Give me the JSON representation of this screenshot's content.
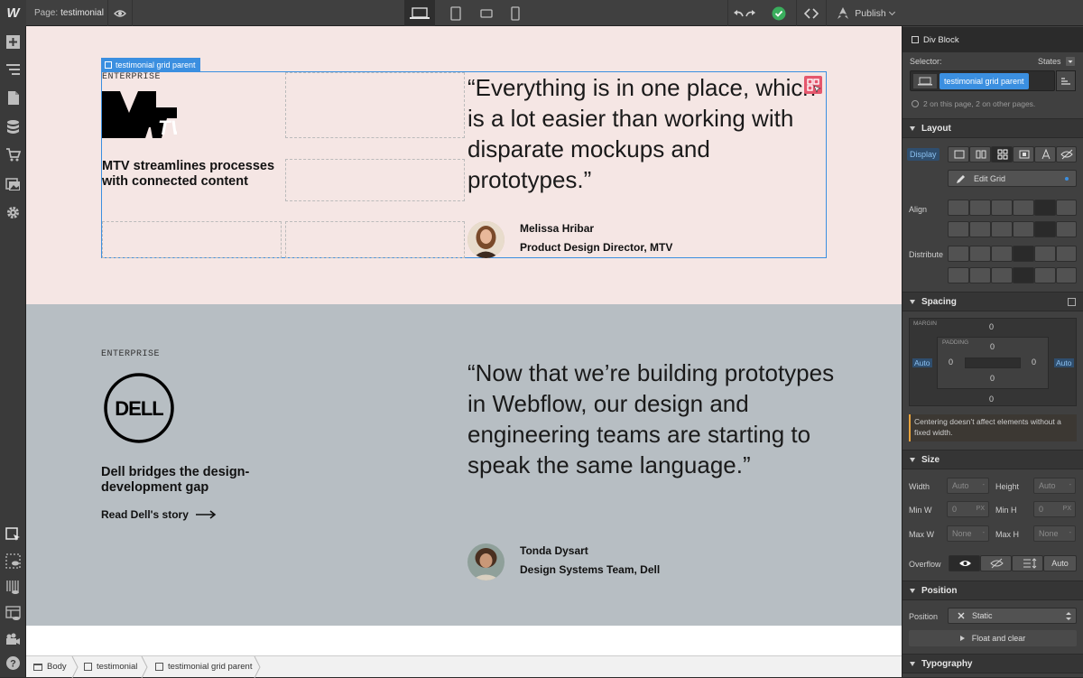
{
  "topbar": {
    "page_label": "Page:",
    "page_name": "testimonial",
    "publish_label": "Publish"
  },
  "panel": {
    "tabs": [
      "style-brush-icon",
      "gear-icon",
      "drops-icon",
      "lightning-icon"
    ],
    "element_type": "Div Block",
    "selector_label": "Selector:",
    "states_label": "States",
    "selector_chip": "testimonial grid parent",
    "usage_note": "2 on this page, 2 on other pages.",
    "layout": {
      "title": "Layout",
      "display_label": "Display",
      "edit_grid_label": "Edit Grid",
      "align_label": "Align",
      "distribute_label": "Distribute"
    },
    "spacing": {
      "title": "Spacing",
      "margin_label": "MARGIN",
      "padding_label": "PADDING",
      "margin_top": "0",
      "margin_bottom": "0",
      "margin_left": "Auto",
      "margin_right": "Auto",
      "padding_top": "0",
      "padding_bottom": "0",
      "padding_left": "0",
      "padding_right": "0",
      "warning": "Centering doesn’t affect elements without a fixed width."
    },
    "size": {
      "title": "Size",
      "width_label": "Width",
      "width_value": "Auto",
      "height_label": "Height",
      "height_value": "Auto",
      "minw_label": "Min W",
      "minw_value": "0",
      "minh_label": "Min H",
      "minh_value": "0",
      "maxw_label": "Max W",
      "maxw_value": "None",
      "maxh_label": "Max H",
      "maxh_value": "None",
      "unit": "PX",
      "overflow_label": "Overflow",
      "overflow_auto": "Auto"
    },
    "position": {
      "title": "Position",
      "position_label": "Position",
      "position_value": "Static",
      "float_label": "Float and clear"
    },
    "typography": {
      "title": "Typography"
    }
  },
  "canvas": {
    "selection_tag": "testimonial grid parent",
    "t1": {
      "eyebrow": "ENTERPRISE",
      "logo_text": "MTV",
      "heading": "MTV streamlines processes with connected content",
      "quote": "“Everything is in one place, which is a lot easier than working with disparate mockups and prototypes.”",
      "name": "Melissa Hribar",
      "role": "Product Design Director, MTV"
    },
    "t2": {
      "eyebrow": "ENTERPRISE",
      "logo_text": "DELL",
      "heading": "Dell bridges the design-development gap",
      "link": "Read Dell's story",
      "quote": "“Now that we’re building prototypes in Webflow, our design and engineering teams are starting to speak the same language.”",
      "name": "Tonda Dysart",
      "role": "Design Systems Team, Dell"
    }
  },
  "breadcrumbs": [
    "Body",
    "testimonial",
    "testimonial grid parent"
  ],
  "colors": {
    "section1_bg": "#f5e6e4",
    "section2_bg": "#b7bec3",
    "accent_blue": "#3b8fe0",
    "publish_check": "#3aae5d"
  }
}
